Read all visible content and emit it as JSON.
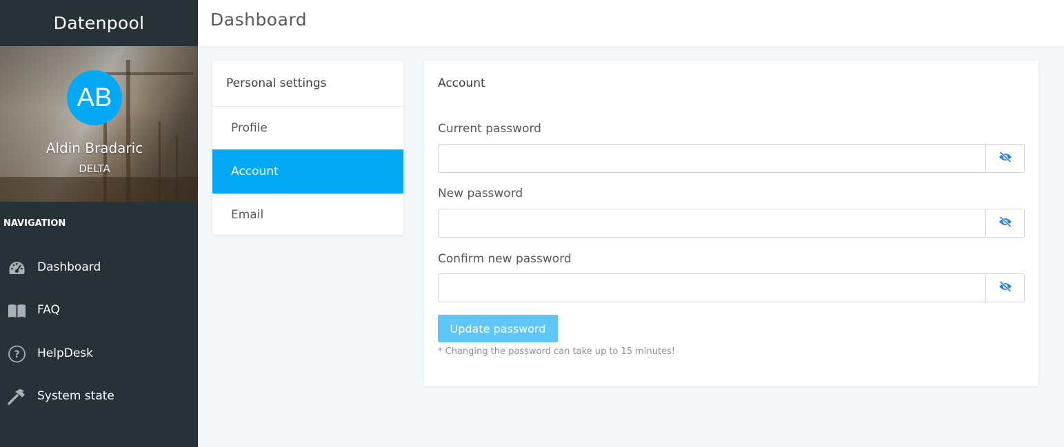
{
  "app": {
    "brand": "Datenpool"
  },
  "user": {
    "initials": "AB",
    "name": "Aldin Bradaric",
    "org": "DELTA",
    "avatar_color": "#03a9f4"
  },
  "sidebar": {
    "heading": "NAVIGATION",
    "items": [
      {
        "label": "Dashboard",
        "icon": "dashboard-gauge-icon"
      },
      {
        "label": "FAQ",
        "icon": "book-icon"
      },
      {
        "label": "HelpDesk",
        "icon": "question-circle-icon"
      },
      {
        "label": "System state",
        "icon": "hammer-icon"
      }
    ]
  },
  "header": {
    "title": "Dashboard"
  },
  "settings_menu": {
    "title": "Personal settings",
    "items": [
      {
        "label": "Profile",
        "active": false
      },
      {
        "label": "Account",
        "active": true
      },
      {
        "label": "Email",
        "active": false
      }
    ]
  },
  "account": {
    "title": "Account",
    "fields": [
      {
        "label": "Current password",
        "value": "",
        "toggle_icon": "eye-slash-icon"
      },
      {
        "label": "New password",
        "value": "",
        "toggle_icon": "eye-slash-icon"
      },
      {
        "label": "Confirm new password",
        "value": "",
        "toggle_icon": "eye-slash-icon"
      }
    ],
    "submit_label": "Update password",
    "hint": "* Changing the password can take up to 15 minutes!"
  },
  "colors": {
    "sidebar_bg": "#263238",
    "accent": "#03a9f4",
    "button_disabled": "#5ec6f8",
    "eye_icon": "#2a7de1"
  }
}
